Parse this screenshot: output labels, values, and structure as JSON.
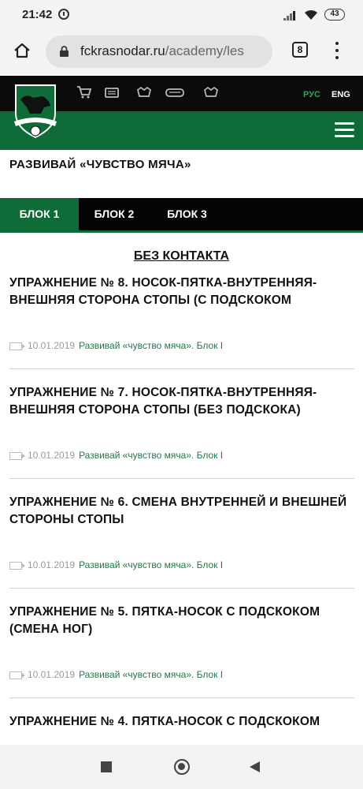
{
  "status_bar": {
    "time": "21:42",
    "battery": "43"
  },
  "browser": {
    "url_host": "fckrasnodar.ru",
    "url_path": "/academy/les",
    "tabs_count": "8"
  },
  "site": {
    "lang_ru": "РУС",
    "lang_en": "ENG",
    "brand_color": "#0f6b38"
  },
  "page": {
    "title": "РАЗВИВАЙ «ЧУВСТВО МЯЧА»",
    "tabs": [
      {
        "label": "БЛОК 1",
        "active": true
      },
      {
        "label": "БЛОК 2",
        "active": false
      },
      {
        "label": "БЛОК 3",
        "active": false
      }
    ],
    "section_heading": "БЕЗ КОНТАКТА"
  },
  "articles": [
    {
      "title": "УПРАЖНЕНИЕ № 8. НОСОК-ПЯТКА-ВНУТРЕННЯЯ-ВНЕШНЯЯ СТОРОНА СТОПЫ (С ПОДСКОКОМ",
      "date": "10.01.2019",
      "tag": "Развивай «чувство мяча». Блок I"
    },
    {
      "title": "УПРАЖНЕНИЕ № 7. НОСОК-ПЯТКА-ВНУТРЕННЯЯ-ВНЕШНЯЯ СТОРОНА СТОПЫ (БЕЗ ПОДСКОКА)",
      "date": "10.01.2019",
      "tag": "Развивай «чувство мяча». Блок I"
    },
    {
      "title": "УПРАЖНЕНИЕ № 6. СМЕНА ВНУТРЕННЕЙ И ВНЕШНЕЙ СТОРОНЫ СТОПЫ",
      "date": "10.01.2019",
      "tag": "Развивай «чувство мяча». Блок I"
    },
    {
      "title": "УПРАЖНЕНИЕ № 5. ПЯТКА-НОСОК С ПОДСКОКОМ (СМЕНА НОГ)",
      "date": "10.01.2019",
      "tag": "Развивай «чувство мяча». Блок I"
    },
    {
      "title": "УПРАЖНЕНИЕ № 4. ПЯТКА-НОСОК С ПОДСКОКОМ",
      "date": "",
      "tag": ""
    }
  ],
  "icons": {
    "status": [
      "alarm-icon",
      "signal-icon",
      "wifi-icon",
      "battery-icon"
    ],
    "browser": [
      "home-icon",
      "lock-icon",
      "tabs-icon",
      "menu-dots-icon"
    ],
    "site_top": [
      "cart-icon",
      "ticket-icon",
      "crest-icon",
      "stadium-icon",
      "crest-icon"
    ],
    "nav": [
      "recents-icon",
      "home-circle-icon",
      "back-icon"
    ]
  }
}
